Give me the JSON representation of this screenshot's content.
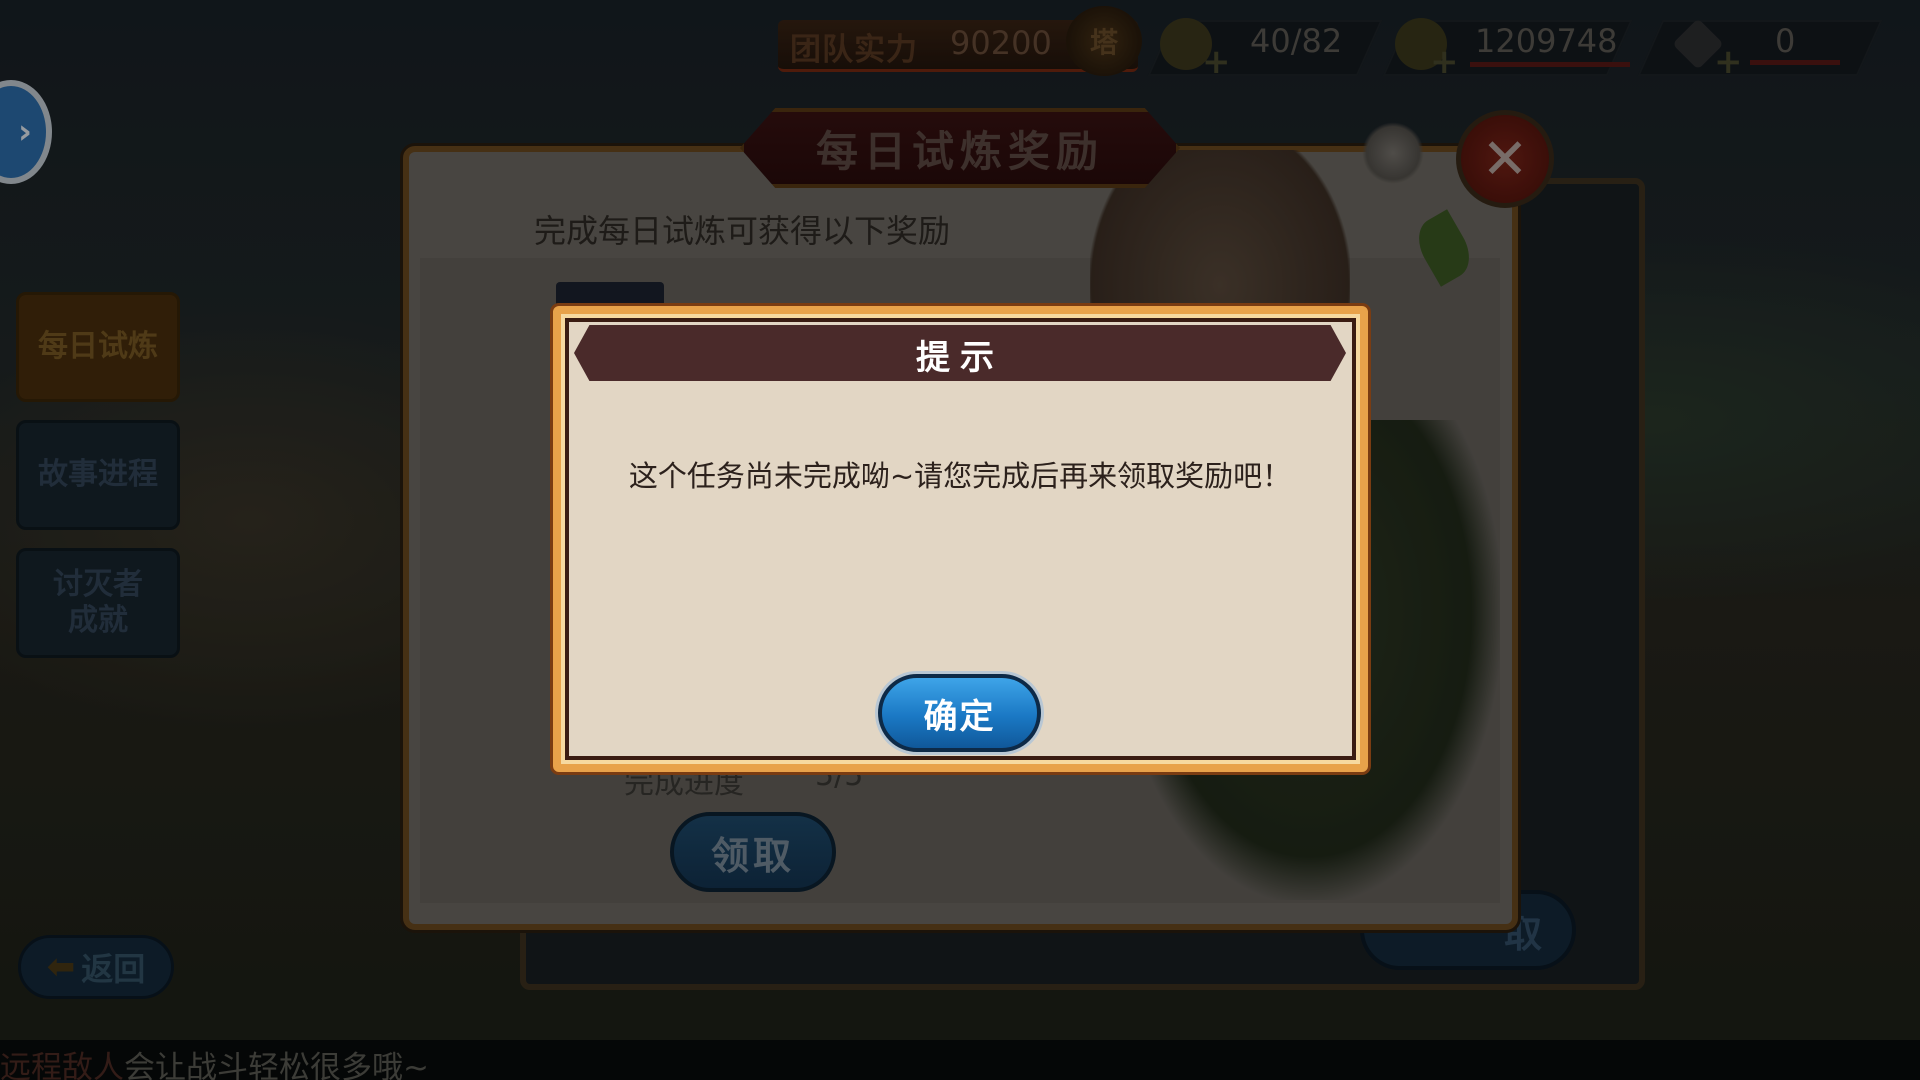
{
  "topbar": {
    "power_label": "团队实力",
    "power_value": "90200",
    "rank_badge": "塔",
    "stamina": "40/82",
    "gold": "1209748",
    "gems": "0"
  },
  "sidebar": {
    "items": [
      {
        "label": "每日试炼"
      },
      {
        "label": "故事进程"
      },
      {
        "label": "讨灭者成就"
      }
    ],
    "back_label": "返回"
  },
  "panel": {
    "title": "每日试炼奖励",
    "subtitle": "完成每日试炼可获得以下奖励",
    "progress_label": "完成进度",
    "progress_value": "5/5",
    "claim_label": "领取",
    "claim_label_2": "取"
  },
  "dialog": {
    "title": "提示",
    "message": "这个任务尚未完成呦~请您完成后再来领取奖励吧！",
    "ok_label": "确定"
  },
  "ticker": {
    "highlight": "远程敌人",
    "text": "会让战斗轻松很多哦~"
  },
  "colors": {
    "dialog_border": "#e8a24a",
    "dialog_header": "#4a2a2a",
    "ok_button": "#1a78c4"
  }
}
